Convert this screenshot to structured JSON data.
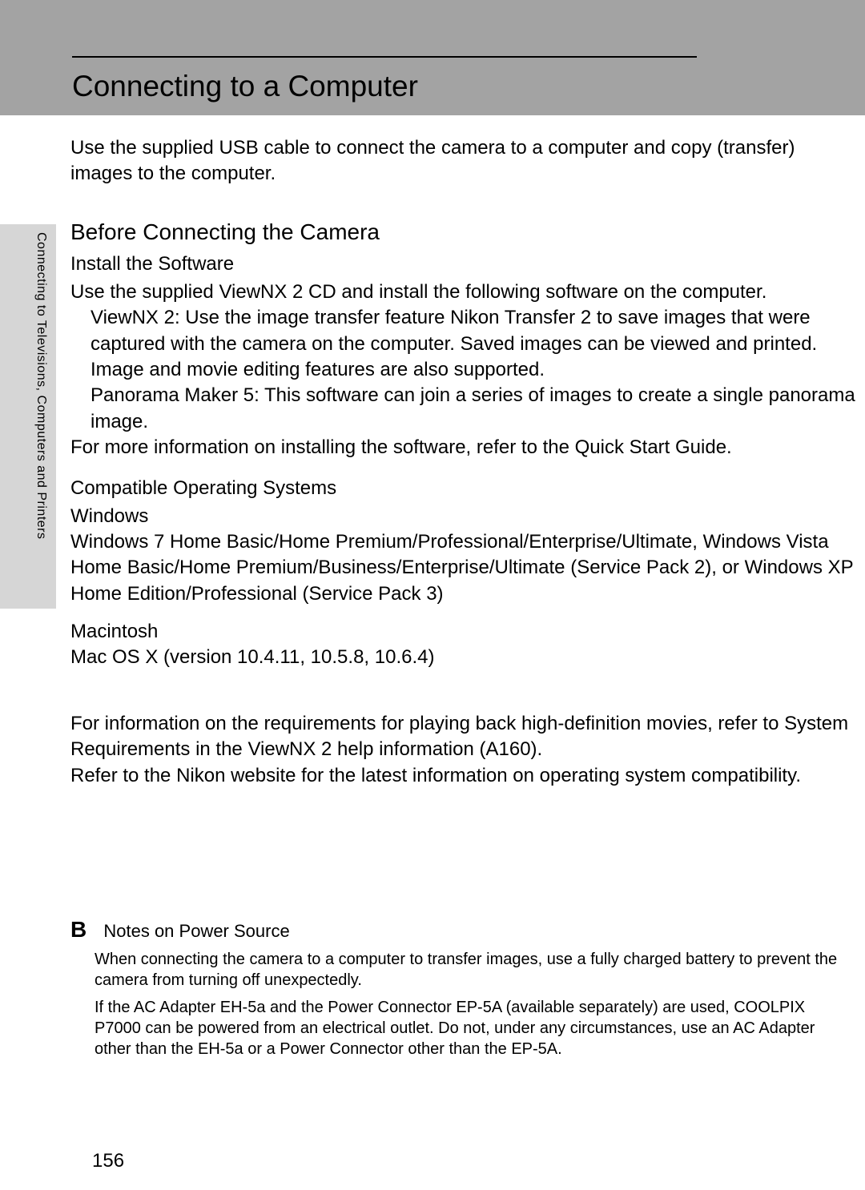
{
  "header": {
    "title": "Connecting to a Computer"
  },
  "sidebar": {
    "label": "Connecting to Televisions, Computers and Printers"
  },
  "intro": "Use the supplied USB cable to connect the camera to a computer and copy (transfer) images to the computer.",
  "section1": {
    "title": "Before Connecting the Camera",
    "install_title": "Install the Software",
    "install_intro": "Use the supplied ViewNX 2 CD and install the following software on the computer.",
    "bullet1": "ViewNX 2: Use the image transfer feature Nikon Transfer 2 to save images that were captured with the camera on the computer. Saved images can be viewed and printed. Image and movie editing features are also supported.",
    "bullet2": "Panorama Maker 5: This software can join a series of images to create a single panorama image.",
    "install_more": "For more information on installing the software, refer to the Quick Start Guide.",
    "compat_title": "Compatible Operating Systems",
    "windows_label": "Windows",
    "windows_text": "Windows 7 Home Basic/Home Premium/Professional/Enterprise/Ultimate, Windows Vista Home Basic/Home Premium/Business/Enterprise/Ultimate (Service Pack 2), or Windows XP Home Edition/Professional (Service Pack 3)",
    "mac_label": "Macintosh",
    "mac_text": "Mac OS X (version 10.4.11, 10.5.8, 10.6.4)",
    "hd_info": "For information on the requirements for playing back high-definition movies, refer to  System Requirements  in the ViewNX 2 help information (A160).",
    "nikon_site": "Refer to the Nikon website for the latest information on operating system compatibility."
  },
  "notes": {
    "icon": "B",
    "title": "Notes on Power Source",
    "line1": "When connecting the camera to a computer to transfer images, use a fully charged battery to prevent the camera from turning off unexpectedly.",
    "line2": "If the AC Adapter EH-5a and the Power Connector EP-5A (available separately) are used, COOLPIX P7000 can be powered from an electrical outlet. Do not, under any circumstances, use an AC Adapter other than the EH-5a or a Power Connector other than the EP-5A."
  },
  "page_number": "156"
}
